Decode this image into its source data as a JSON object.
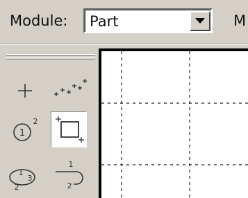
{
  "context_bar": {
    "module_label": "Module:",
    "module_value": "Part",
    "next_label": "M"
  },
  "toolbox": {
    "tools": [
      {
        "name": "create-point-icon",
        "active": false
      },
      {
        "name": "create-points-icon",
        "active": false
      },
      {
        "name": "circle-center-perimeter-icon",
        "active": false
      },
      {
        "name": "rectangle-icon",
        "active": true
      },
      {
        "name": "ellipse-icon",
        "active": false
      },
      {
        "name": "fillet-arc-icon",
        "active": false
      }
    ]
  },
  "viewport": {
    "grid": "dashed"
  }
}
